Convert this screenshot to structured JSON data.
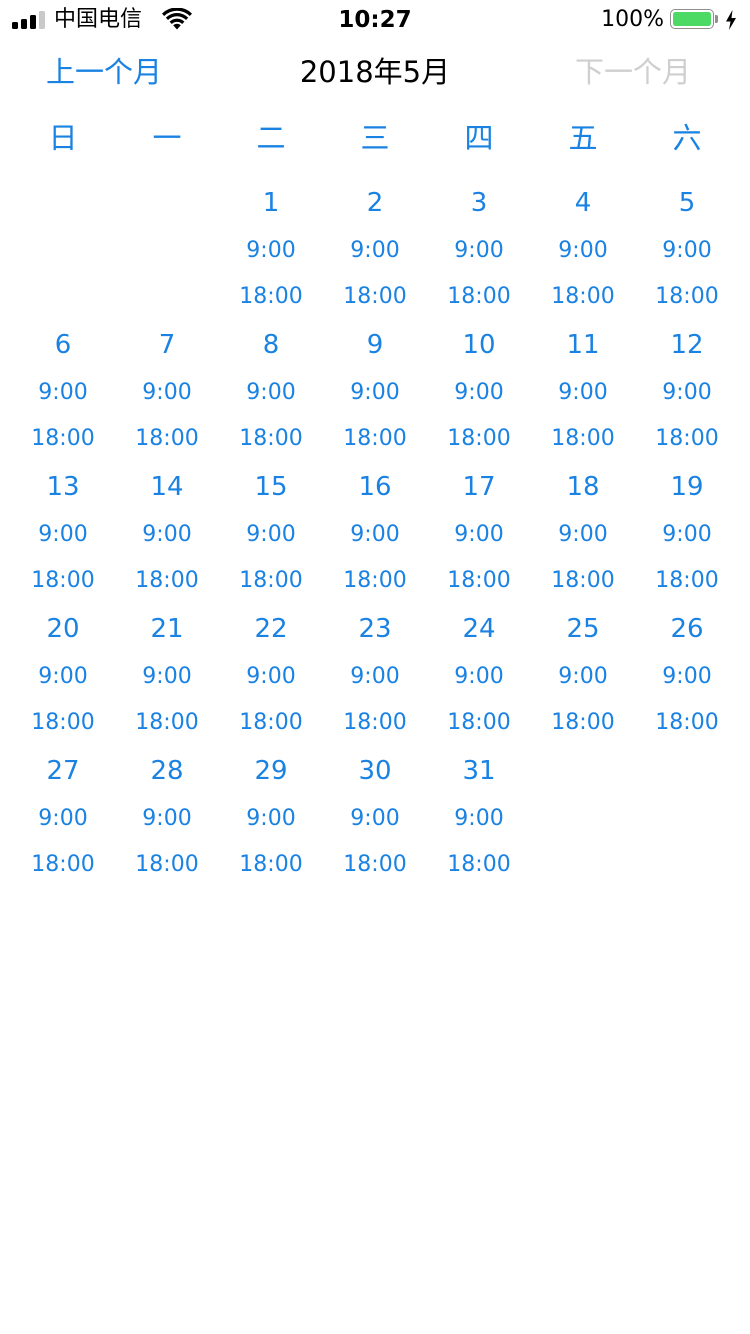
{
  "status_bar": {
    "carrier": "中国电信",
    "time": "10:27",
    "battery_percent": "100%",
    "signal_icon": "signal-bars-icon",
    "wifi_icon": "wifi-icon",
    "battery_icon": "battery-icon",
    "charging_icon": "charging-bolt-icon",
    "battery_color": "#4cd964"
  },
  "nav": {
    "prev_label": "上一个月",
    "title": "2018年5月",
    "next_label": "下一个月",
    "accent_color": "#1a82e2",
    "disabled_color": "#cfcfcf"
  },
  "weekdays": [
    "日",
    "一",
    "二",
    "三",
    "四",
    "五",
    "六"
  ],
  "weeks": [
    [
      null,
      null,
      {
        "day": "1",
        "times": [
          "9:00",
          "18:00"
        ]
      },
      {
        "day": "2",
        "times": [
          "9:00",
          "18:00"
        ]
      },
      {
        "day": "3",
        "times": [
          "9:00",
          "18:00"
        ]
      },
      {
        "day": "4",
        "times": [
          "9:00",
          "18:00"
        ]
      },
      {
        "day": "5",
        "times": [
          "9:00",
          "18:00"
        ]
      }
    ],
    [
      {
        "day": "6",
        "times": [
          "9:00",
          "18:00"
        ]
      },
      {
        "day": "7",
        "times": [
          "9:00",
          "18:00"
        ]
      },
      {
        "day": "8",
        "times": [
          "9:00",
          "18:00"
        ]
      },
      {
        "day": "9",
        "times": [
          "9:00",
          "18:00"
        ]
      },
      {
        "day": "10",
        "times": [
          "9:00",
          "18:00"
        ]
      },
      {
        "day": "11",
        "times": [
          "9:00",
          "18:00"
        ]
      },
      {
        "day": "12",
        "times": [
          "9:00",
          "18:00"
        ]
      }
    ],
    [
      {
        "day": "13",
        "times": [
          "9:00",
          "18:00"
        ]
      },
      {
        "day": "14",
        "times": [
          "9:00",
          "18:00"
        ]
      },
      {
        "day": "15",
        "times": [
          "9:00",
          "18:00"
        ]
      },
      {
        "day": "16",
        "times": [
          "9:00",
          "18:00"
        ]
      },
      {
        "day": "17",
        "times": [
          "9:00",
          "18:00"
        ]
      },
      {
        "day": "18",
        "times": [
          "9:00",
          "18:00"
        ]
      },
      {
        "day": "19",
        "times": [
          "9:00",
          "18:00"
        ]
      }
    ],
    [
      {
        "day": "20",
        "times": [
          "9:00",
          "18:00"
        ]
      },
      {
        "day": "21",
        "times": [
          "9:00",
          "18:00"
        ]
      },
      {
        "day": "22",
        "times": [
          "9:00",
          "18:00"
        ]
      },
      {
        "day": "23",
        "times": [
          "9:00",
          "18:00"
        ]
      },
      {
        "day": "24",
        "times": [
          "9:00",
          "18:00"
        ]
      },
      {
        "day": "25",
        "times": [
          "9:00",
          "18:00"
        ]
      },
      {
        "day": "26",
        "times": [
          "9:00",
          "18:00"
        ]
      }
    ],
    [
      {
        "day": "27",
        "times": [
          "9:00",
          "18:00"
        ]
      },
      {
        "day": "28",
        "times": [
          "9:00",
          "18:00"
        ]
      },
      {
        "day": "29",
        "times": [
          "9:00",
          "18:00"
        ]
      },
      {
        "day": "30",
        "times": [
          "9:00",
          "18:00"
        ]
      },
      {
        "day": "31",
        "times": [
          "9:00",
          "18:00"
        ]
      },
      null,
      null
    ]
  ]
}
